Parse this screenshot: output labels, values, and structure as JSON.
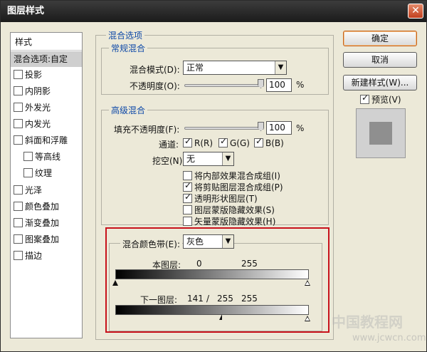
{
  "window": {
    "title": "图层样式",
    "close_glyph": "✕"
  },
  "sidebar": {
    "header": "样式",
    "items": [
      {
        "label": "混合选项:自定",
        "selected": true,
        "checkbox": false
      },
      {
        "label": "投影",
        "checkbox": true,
        "checked": false
      },
      {
        "label": "内阴影",
        "checkbox": true,
        "checked": false
      },
      {
        "label": "外发光",
        "checkbox": true,
        "checked": false
      },
      {
        "label": "内发光",
        "checkbox": true,
        "checked": false
      },
      {
        "label": "斜面和浮雕",
        "checkbox": true,
        "checked": false
      },
      {
        "label": "等高线",
        "checkbox": true,
        "checked": false,
        "indent": true
      },
      {
        "label": "纹理",
        "checkbox": true,
        "checked": false,
        "indent": true
      },
      {
        "label": "光泽",
        "checkbox": true,
        "checked": false
      },
      {
        "label": "颜色叠加",
        "checkbox": true,
        "checked": false
      },
      {
        "label": "渐变叠加",
        "checkbox": true,
        "checked": false
      },
      {
        "label": "图案叠加",
        "checkbox": true,
        "checked": false
      },
      {
        "label": "描边",
        "checkbox": true,
        "checked": false
      }
    ]
  },
  "blend_options": {
    "title": "混合选项",
    "general": {
      "title": "常规混合",
      "mode_label": "混合模式(D):",
      "mode_value": "正常",
      "opacity_label": "不透明度(O):",
      "opacity_value": "100",
      "opacity_unit": "%",
      "opacity_level": 1.0
    },
    "advanced": {
      "title": "高级混合",
      "fill_label": "填充不透明度(F):",
      "fill_value": "100",
      "fill_unit": "%",
      "fill_level": 1.0,
      "channels_label": "通道:",
      "channel_r": "R(R)",
      "channel_g": "G(G)",
      "channel_b": "B(B)",
      "knockout_label": "挖空(N):",
      "knockout_value": "无",
      "options": [
        {
          "label": "将内部效果混合成组(I)",
          "checked": false
        },
        {
          "label": "将剪贴图层混合成组(P)",
          "checked": true
        },
        {
          "label": "透明形状图层(T)",
          "checked": true
        },
        {
          "label": "图层蒙版隐藏效果(S)",
          "checked": false
        },
        {
          "label": "矢量蒙版隐藏效果(H)",
          "checked": false
        }
      ]
    },
    "blend_if": {
      "label": "混合颜色带(E):",
      "value": "灰色",
      "this_layer_label": "本图层:",
      "this_layer_low": "0",
      "this_layer_high": "255",
      "underlying_label": "下一图层:",
      "underlying_low": "141",
      "underlying_sep": "/",
      "underlying_split": "255",
      "underlying_high": "255"
    }
  },
  "buttons": {
    "ok": "确定",
    "cancel": "取消",
    "new_style": "新建样式(W)...",
    "preview": "预览(V)"
  },
  "watermark": {
    "line1": "中国教程网",
    "line2": "www.jcwcn.com"
  },
  "colors": {
    "accent_legend": "#0e49a8",
    "highlight_box": "#c8121b",
    "close_button": "#c2401f"
  }
}
